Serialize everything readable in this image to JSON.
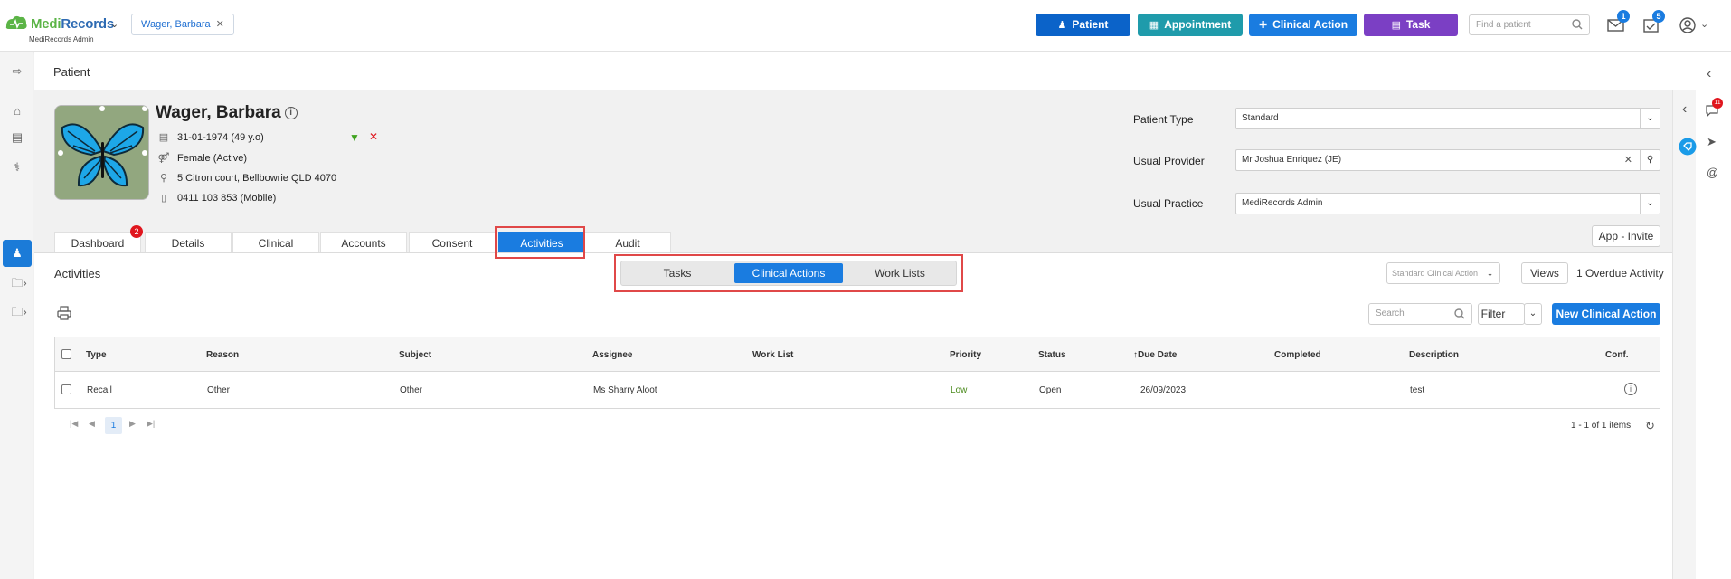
{
  "header": {
    "brand_medi": "Medi",
    "brand_records": "Records",
    "brand_sub": "MediRecords Admin",
    "patient_chip": "Wager, Barbara",
    "buttons": {
      "patient": "Patient",
      "appointment": "Appointment",
      "clinical_action": "Clinical Action",
      "task": "Task"
    },
    "find_placeholder": "Find a patient",
    "mail_count": "1",
    "tasks_count": "5"
  },
  "breadcrumb": "Patient",
  "patient": {
    "name": "Wager, Barbara",
    "dob": "31-01-1974 (49 y.o)",
    "gender": "Female (Active)",
    "address": "5 Citron court, Bellbowrie QLD 4070",
    "phone": "0411 103 853 (Mobile)"
  },
  "fields": {
    "patient_type_label": "Patient Type",
    "patient_type_value": "Standard",
    "usual_provider_label": "Usual Provider",
    "usual_provider_value": "Mr Joshua Enriquez (JE)",
    "usual_practice_label": "Usual Practice",
    "usual_practice_value": "MediRecords Admin",
    "app_invite": "App - Invite"
  },
  "tabs": [
    "Dashboard",
    "Details",
    "Clinical",
    "Accounts",
    "Consent",
    "Activities",
    "Audit"
  ],
  "dashboard_badge": "2",
  "right_rail_badge": "11",
  "activities": {
    "title": "Activities",
    "segments": [
      "Tasks",
      "Clinical Actions",
      "Work Lists"
    ],
    "type_select": "Standard Clinical Action",
    "views": "Views",
    "overdue": "1 Overdue Activity",
    "search_placeholder": "Search",
    "filter": "Filter",
    "new_action": "New Clinical Action"
  },
  "table": {
    "columns": [
      "Type",
      "Reason",
      "Subject",
      "Assignee",
      "Work List",
      "Priority",
      "Status",
      "Due Date",
      "Completed",
      "Description",
      "Conf."
    ],
    "rows": [
      {
        "type": "Recall",
        "reason": "Other",
        "subject": "Other",
        "assignee": "Ms Sharry Aloot",
        "work_list": "",
        "priority": "Low",
        "status": "Open",
        "due_date": "26/09/2023",
        "completed": "",
        "description": "test"
      }
    ]
  },
  "pager": {
    "current": "1",
    "summary": "1 - 1 of 1 items"
  },
  "colors": {
    "primary": "#1a7ce0",
    "patient_btn": "#0b63c9",
    "appointment_btn": "#1f9bab",
    "clinical_btn": "#1a7ce0",
    "task_btn": "#7b3fc4",
    "priority_low": "#4a8a1c",
    "highlight": "#e04848"
  }
}
